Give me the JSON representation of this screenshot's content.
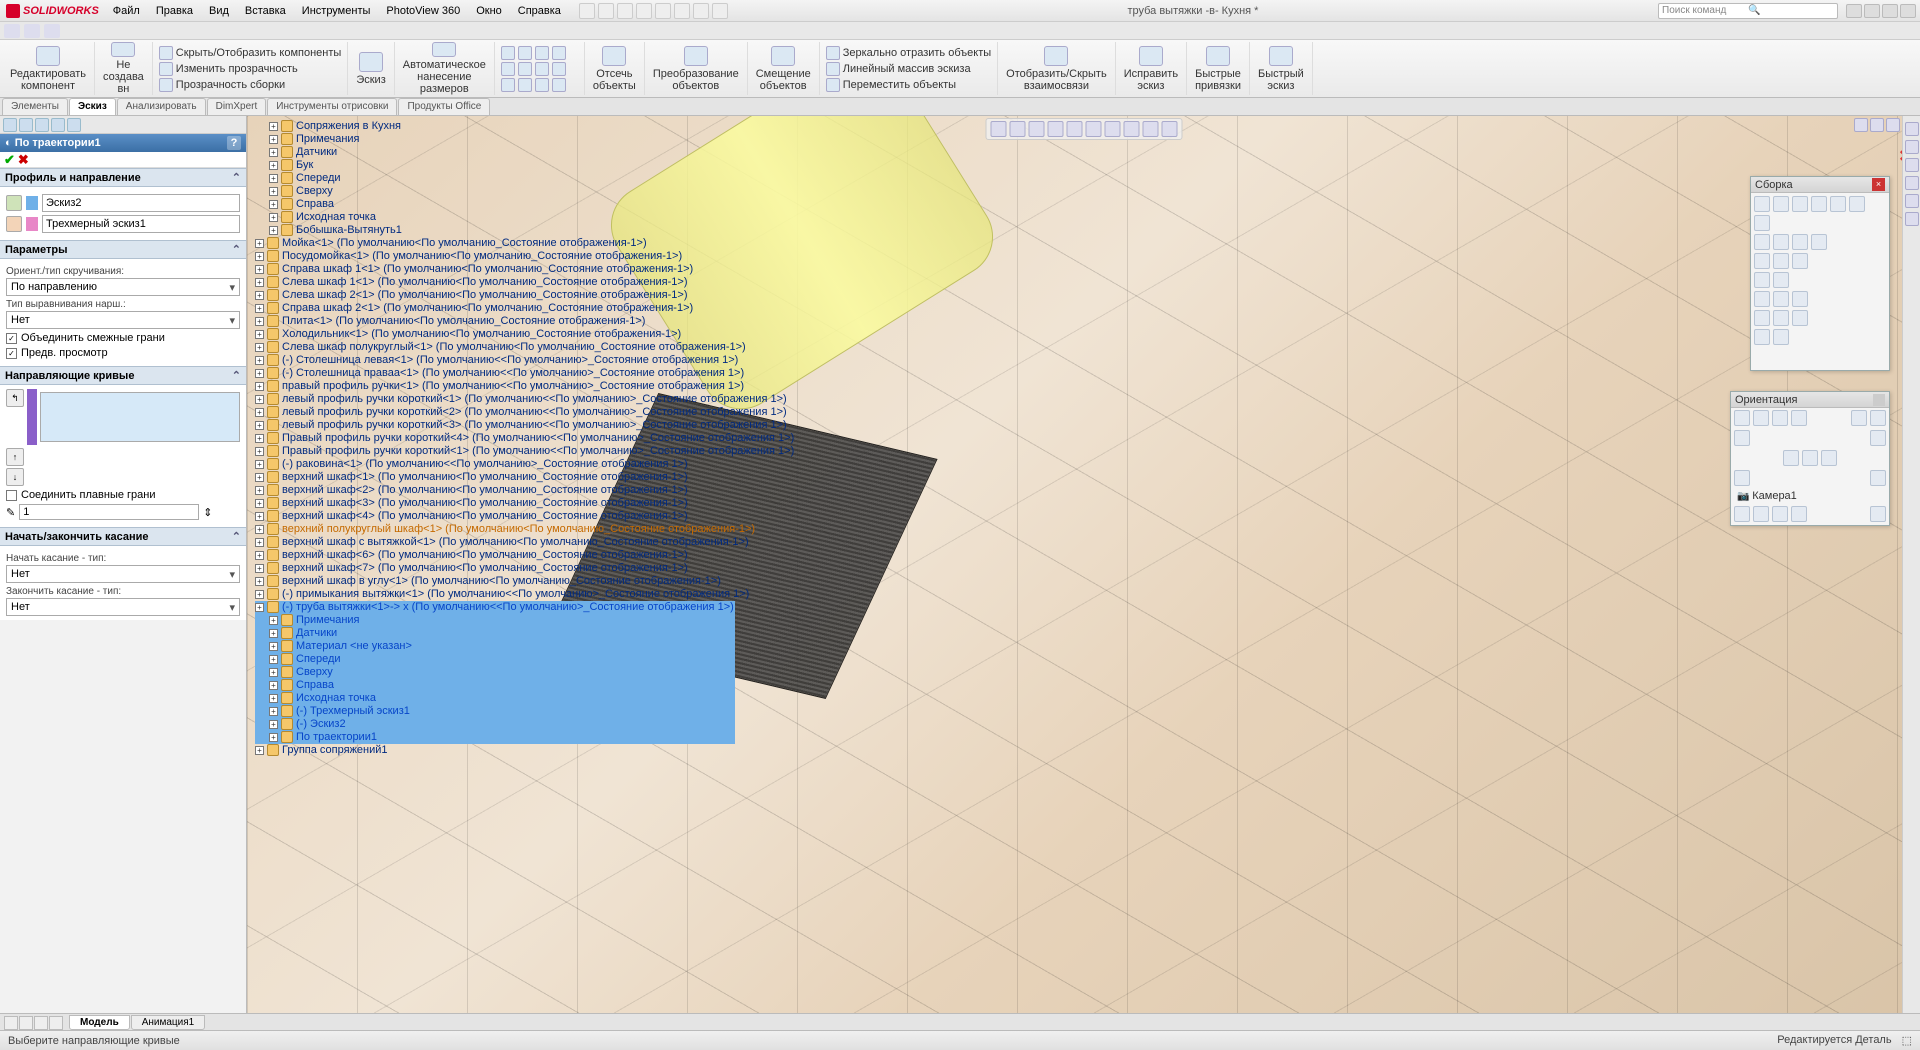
{
  "app": {
    "logo": "SOLIDWORKS",
    "title": "труба вытяжки -в- Кухня *",
    "search_placeholder": "Поиск команд"
  },
  "menu": [
    "Файл",
    "Правка",
    "Вид",
    "Вставка",
    "Инструменты",
    "PhotoView 360",
    "Окно",
    "Справка"
  ],
  "ribbon": {
    "edit_component": "Редактировать\nкомпонент",
    "no_create": "Не\nсоздава\nвн",
    "hide_show": "Скрыть/Отобразить компоненты",
    "change_trans": "Изменить прозрачность",
    "assy_trans": "Прозрачность сборки",
    "sketch": "Эскиз",
    "auto_dim": "Автоматическое\nнанесение\nразмеров",
    "trim": "Отсечь\nобъекты",
    "transform": "Преобразование\nобъектов",
    "offset": "Смещение\nобъектов",
    "mirror": "Зеркально отразить объекты",
    "linear": "Линейный массив эскиза",
    "move": "Переместить объекты",
    "disp_hide": "Отобразить/Скрыть\nвзаимосвязи",
    "repair": "Исправить\nэскиз",
    "snaps": "Быстрые\nпривязки",
    "quick_sketch": "Быстрый\nэскиз"
  },
  "tabs": [
    "Элементы",
    "Эскиз",
    "Анализировать",
    "DimXpert",
    "Инструменты отрисовки",
    "Продукты Office"
  ],
  "tabs_active": 1,
  "pm": {
    "title": "По траектории1",
    "sec_profile": "Профиль и направление",
    "profile_value": "Эскиз2",
    "path_value": "Трехмерный эскиз1",
    "sec_params": "Параметры",
    "twist_label": "Ориент./тип скручивания:",
    "twist_value": "По направлению",
    "align_label": "Тип выравнивания нарш.:",
    "align_value": "Нет",
    "merge": "Объединить смежные грани",
    "preview": "Предв. просмотр",
    "sec_guides": "Направляющие кривые",
    "merge_smooth": "Соединить плавные грани",
    "num_value": "1",
    "sec_tangent": "Начать/закончить касание",
    "start_label": "Начать касание - тип:",
    "start_value": "Нет",
    "end_label": "Закончить касание - тип:",
    "end_value": "Нет"
  },
  "tree": {
    "top": [
      "Сопряжения в Кухня",
      "Примечания",
      "Датчики",
      "Бук",
      "Спереди",
      "Сверху",
      "Справа",
      "Исходная точка",
      "Бобышка-Вытянуть1"
    ],
    "parts": [
      "Мойка<1> (По умолчанию<По умолчанию_Состояние отображения-1>)",
      "Посудомойка<1> (По умолчанию<По умолчанию_Состояние отображения-1>)",
      "Справа шкаф 1<1> (По умолчанию<По умолчанию_Состояние отображения-1>)",
      "Слева шкаф 1<1> (По умолчанию<По умолчанию_Состояние отображения-1>)",
      "Слева шкаф 2<1> (По умолчанию<По умолчанию_Состояние отображения-1>)",
      "Справа шкаф 2<1> (По умолчанию<По умолчанию_Состояние отображения-1>)",
      "Плита<1> (По умолчанию<По умолчанию_Состояние отображения-1>)",
      "Холодильник<1> (По умолчанию<По умолчанию_Состояние отображения-1>)",
      "Слева шкаф полукруглый<1> (По умолчанию<По умолчанию_Состояние отображения-1>)",
      "(-) Столешница левая<1> (По умолчанию<<По умолчанию>_Состояние отображения 1>)",
      "(-) Столешница праваа<1> (По умолчанию<<По умолчанию>_Состояние отображения 1>)",
      "правый профиль ручки<1> (По умолчанию<<По умолчанию>_Состояние отображения 1>)",
      "левый профиль ручки короткий<1> (По умолчанию<<По умолчанию>_Состояние отображения 1>)",
      "левый профиль ручки короткий<2> (По умолчанию<<По умолчанию>_Состояние отображения 1>)",
      "левый профиль ручки короткий<3> (По умолчанию<<По умолчанию>_Состояние отображения 1>)",
      "Правый профиль ручки короткий<4> (По умолчанию<<По умолчанию>_Состояние отображения 1>)",
      "Правый профиль ручки короткий<1> (По умолчанию<<По умолчанию>_Состояние отображения 1>)",
      "(-) раковина<1> (По умолчанию<<По умолчанию>_Состояние отображения 1>)",
      "верхний шкаф<1> (По умолчанию<По умолчанию_Состояние отображения-1>)",
      "верхний шкаф<2> (По умолчанию<По умолчанию_Состояние отображения-1>)",
      "верхний шкаф<3> (По умолчанию<По умолчанию_Состояние отображения-1>)",
      "верхний шкаф<4> (По умолчанию<По умолчанию_Состояние отображения-1>)"
    ],
    "orange": "верхний полукруглый шкаф<1> (По умолчанию<По умолчанию_Состояние отображения-1>)",
    "parts2": [
      "верхний шкаф с вытяжкой<1> (По умолчанию<По умолчанию_Состояние отображения-1>)",
      "верхний шкаф<6> (По умолчанию<По умолчанию_Состояние отображения-1>)",
      "верхний шкаф<7> (По умолчанию<По умолчанию_Состояние отображения-1>)",
      "верхний шкаф в углу<1> (По умолчанию<По умолчанию_Состояние отображения-1>)",
      "(-) примыкания вытяжки<1> (По умолчанию<<По умолчанию>_Состояние отображения 1>)"
    ],
    "blue_main": "(-) труба вытяжки<1>-> x (По умолчанию<<По умолчанию>_Состояние отображения 1>)",
    "blue_children": [
      "Примечания",
      "Датчики",
      "Материал <не указан>",
      "Спереди",
      "Сверху",
      "Справа",
      "Исходная точка",
      "(-) Трехмерный эскиз1",
      "(-) Эскиз2",
      "По траектории1"
    ],
    "last": "Группа сопряжений1"
  },
  "float": {
    "assembly_title": "Сборка",
    "orientation_title": "Ориентация",
    "camera": "Камера1"
  },
  "bottom_tabs": [
    "Модель",
    "Анимация1"
  ],
  "status_left": "Выберите направляющие кривые",
  "status_right": "Редактируется Деталь"
}
